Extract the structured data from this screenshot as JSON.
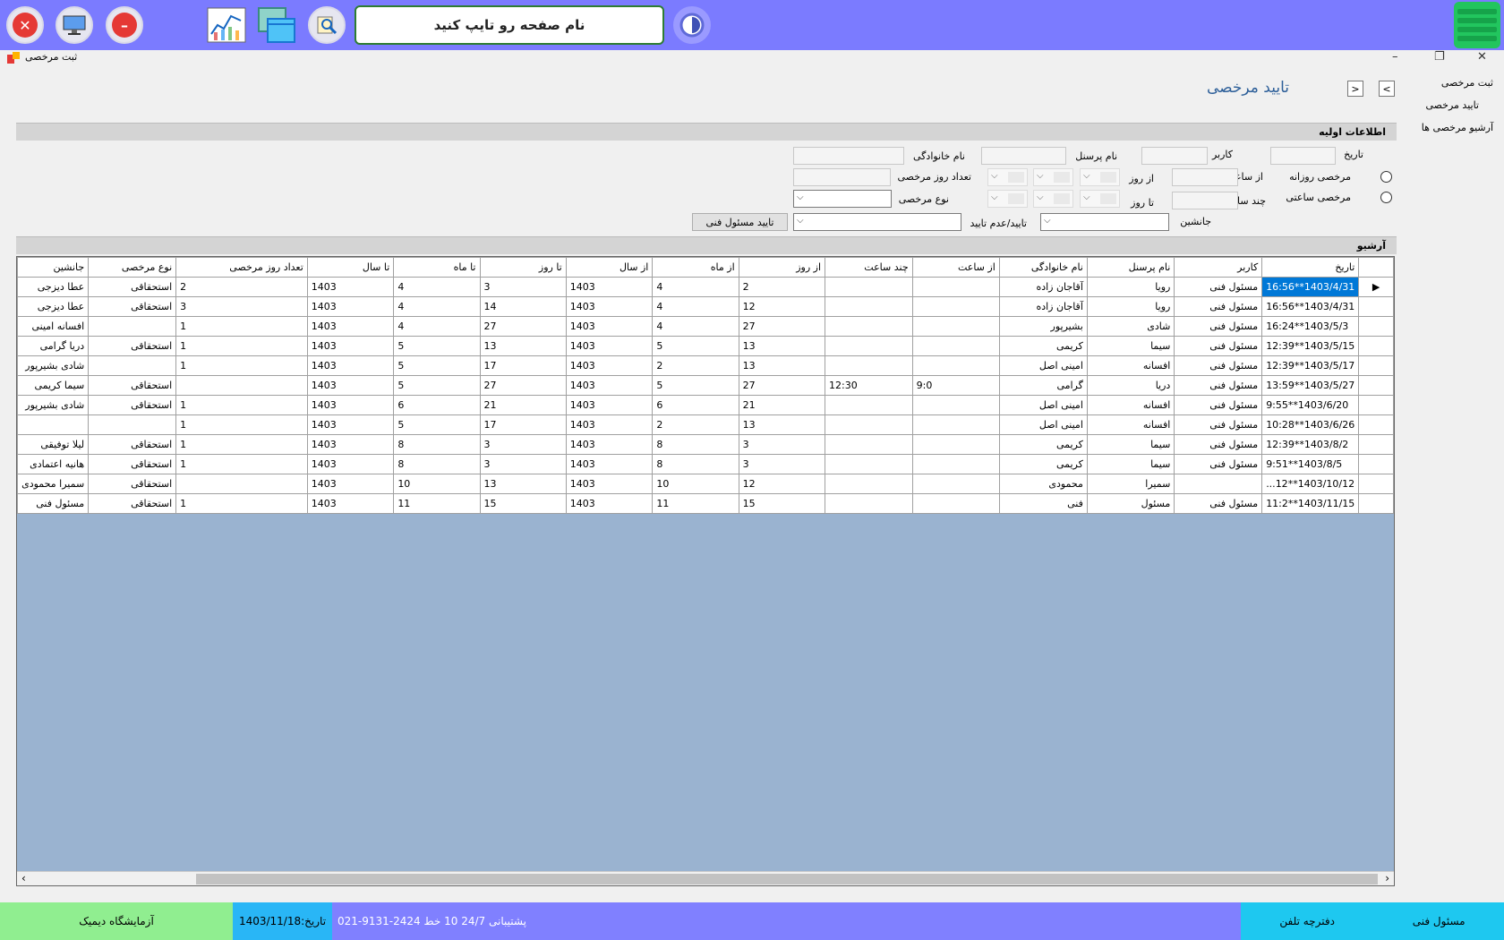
{
  "toolbar": {
    "search_placeholder": "نام صفحه رو تایپ کنید"
  },
  "window": {
    "title": "ثبت مرخصی",
    "minimize": "–",
    "restore": "❐",
    "close": "✕"
  },
  "nav": {
    "items": [
      "ثبت مرخصی",
      "تایید مرخصی",
      "آرشیو مرخصی ها"
    ]
  },
  "page": {
    "heading": "تایید مرخصی"
  },
  "form": {
    "section_title": "اطلاعات اولیه",
    "date_label": "تاریخ",
    "user_label": "کاربر",
    "personnel_name_label": "نام پرسنل",
    "family_name_label": "نام خانوادگی",
    "daily_leave_label": "مرخصی روزانه",
    "hourly_leave_label": "مرخصی ساعتی",
    "from_hour_label": "از ساعت",
    "how_many_hours_label": "چند ساعت",
    "from_day_label": "از روز",
    "to_day_label": "تا روز",
    "leave_days_count_label": "تعداد روز مرخصی",
    "leave_type_label": "نوع مرخصی",
    "substitute_label": "جانشین",
    "approve_reject_label": "تایید/عدم تایید",
    "approve_button": "تایید مسئول فنی"
  },
  "archive": {
    "section_title": "آرشیو",
    "columns": [
      "تاریخ",
      "کاربر",
      "نام پرسنل",
      "نام خانوادگی",
      "از ساعت",
      "چند ساعت",
      "از روز",
      "از ماه",
      "از سال",
      "تا روز",
      "تا ماه",
      "تا سال",
      "تعداد روز مرخصی",
      "نوع مرخصی",
      "جانشین"
    ],
    "rows": [
      [
        "1403/4/31**16:56",
        "مسئول فنی",
        "رویا",
        "آقاجان زاده",
        "",
        "",
        "2",
        "4",
        "1403",
        "3",
        "4",
        "1403",
        "2",
        "استحقاقی",
        "عطا دیزجی"
      ],
      [
        "1403/4/31**16:56",
        "مسئول فنی",
        "رویا",
        "آقاجان زاده",
        "",
        "",
        "12",
        "4",
        "1403",
        "14",
        "4",
        "1403",
        "3",
        "استحقاقی",
        "عطا دیزجی"
      ],
      [
        "1403/5/3**16:24",
        "مسئول فنی",
        "شادی",
        "بشیرپور",
        "",
        "",
        "27",
        "4",
        "1403",
        "27",
        "4",
        "1403",
        "1",
        "",
        "افسانه امینی"
      ],
      [
        "1403/5/15**12:39",
        "مسئول فنی",
        "سیما",
        "کریمی",
        "",
        "",
        "13",
        "5",
        "1403",
        "13",
        "5",
        "1403",
        "1",
        "استحقاقی",
        "دریا گرامی"
      ],
      [
        "1403/5/17**12:39",
        "مسئول فنی",
        "افسانه",
        "امینی اصل",
        "",
        "",
        "13",
        "2",
        "1403",
        "17",
        "5",
        "1403",
        "1",
        "",
        "شادی بشیرپور"
      ],
      [
        "1403/5/27**13:59",
        "مسئول فنی",
        "دریا",
        "گرامی",
        "9:0",
        "12:30",
        "27",
        "5",
        "1403",
        "27",
        "5",
        "1403",
        "",
        "استحقاقی",
        "سیما کریمی"
      ],
      [
        "1403/6/20**9:55",
        "مسئول فنی",
        "افسانه",
        "امینی اصل",
        "",
        "",
        "21",
        "6",
        "1403",
        "21",
        "6",
        "1403",
        "1",
        "استحقاقی",
        "شادی بشیرپور"
      ],
      [
        "1403/6/26**10:28",
        "مسئول فنی",
        "افسانه",
        "امینی اصل",
        "",
        "",
        "13",
        "2",
        "1403",
        "17",
        "5",
        "1403",
        "1",
        "",
        ""
      ],
      [
        "1403/8/2**12:39",
        "مسئول فنی",
        "سیما",
        "کریمی",
        "",
        "",
        "3",
        "8",
        "1403",
        "3",
        "8",
        "1403",
        "1",
        "استحقاقی",
        "لیلا توفیقی"
      ],
      [
        "1403/8/5**9:51",
        "مسئول فنی",
        "سیما",
        "کریمی",
        "",
        "",
        "3",
        "8",
        "1403",
        "3",
        "8",
        "1403",
        "1",
        "استحقاقی",
        "هانیه اعتمادی"
      ],
      [
        "1403/10/12**12...",
        "",
        "سمیرا",
        "محمودی",
        "",
        "",
        "12",
        "10",
        "1403",
        "13",
        "10",
        "1403",
        "",
        "استحقاقی",
        "سمیرا محمودی"
      ],
      [
        "1403/11/15**11:2",
        "مسئول فنی",
        "مسئول",
        "فنی",
        "",
        "",
        "15",
        "11",
        "1403",
        "15",
        "11",
        "1403",
        "1",
        "استحقاقی",
        "مسئول فنی"
      ]
    ]
  },
  "status": {
    "user_role": "مسئول فنی",
    "phonebook": "دفترچه تلفن",
    "support": "پشتیبانی 24/7   10 خط  2424-9131-021",
    "date": "تاریخ:1403/11/18",
    "lab_name": "آزمایشگاه دیمیک"
  },
  "colors": {
    "topbar": "#7b7bff",
    "grid_bg": "#9ab3d0",
    "selection": "#0078d7",
    "status_cyan": "#1ec8f0",
    "status_purple": "#8080ff",
    "status_date": "#29b6f6",
    "status_green": "#90ee90"
  }
}
